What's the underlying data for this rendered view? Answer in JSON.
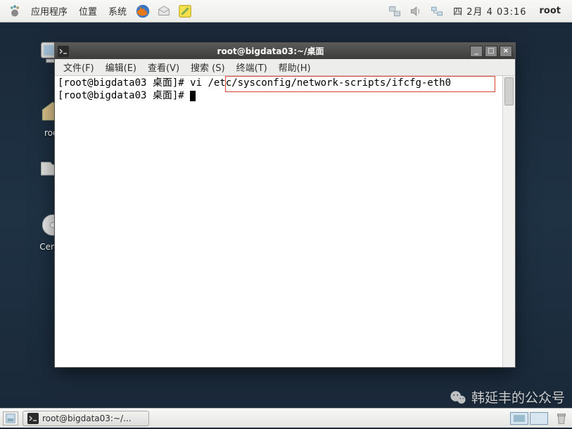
{
  "top_panel": {
    "menus": {
      "apps": "应用程序",
      "places": "位置",
      "system": "系统"
    },
    "clock": "四 2月  4 03:16",
    "user": "root"
  },
  "desktop": {
    "home_label": "root",
    "centos_label": "CentO"
  },
  "terminal": {
    "title": "root@bigdata03:~/桌面",
    "menubar": {
      "file": "文件(F)",
      "edit": "编辑(E)",
      "view": "查看(V)",
      "search": "搜索 (S)",
      "terminal": "终端(T)",
      "help": "帮助(H)"
    },
    "lines": {
      "l1_prompt": "[root@bigdata03 桌面]# ",
      "l1_cmd": "vi /etc/sysconfig/network-scripts/ifcfg-eth0",
      "l2_prompt": "[root@bigdata03 桌面]# "
    }
  },
  "taskbar": {
    "task1": "root@bigdata03:~/..."
  },
  "watermark": {
    "text": "韩延丰的公众号"
  }
}
